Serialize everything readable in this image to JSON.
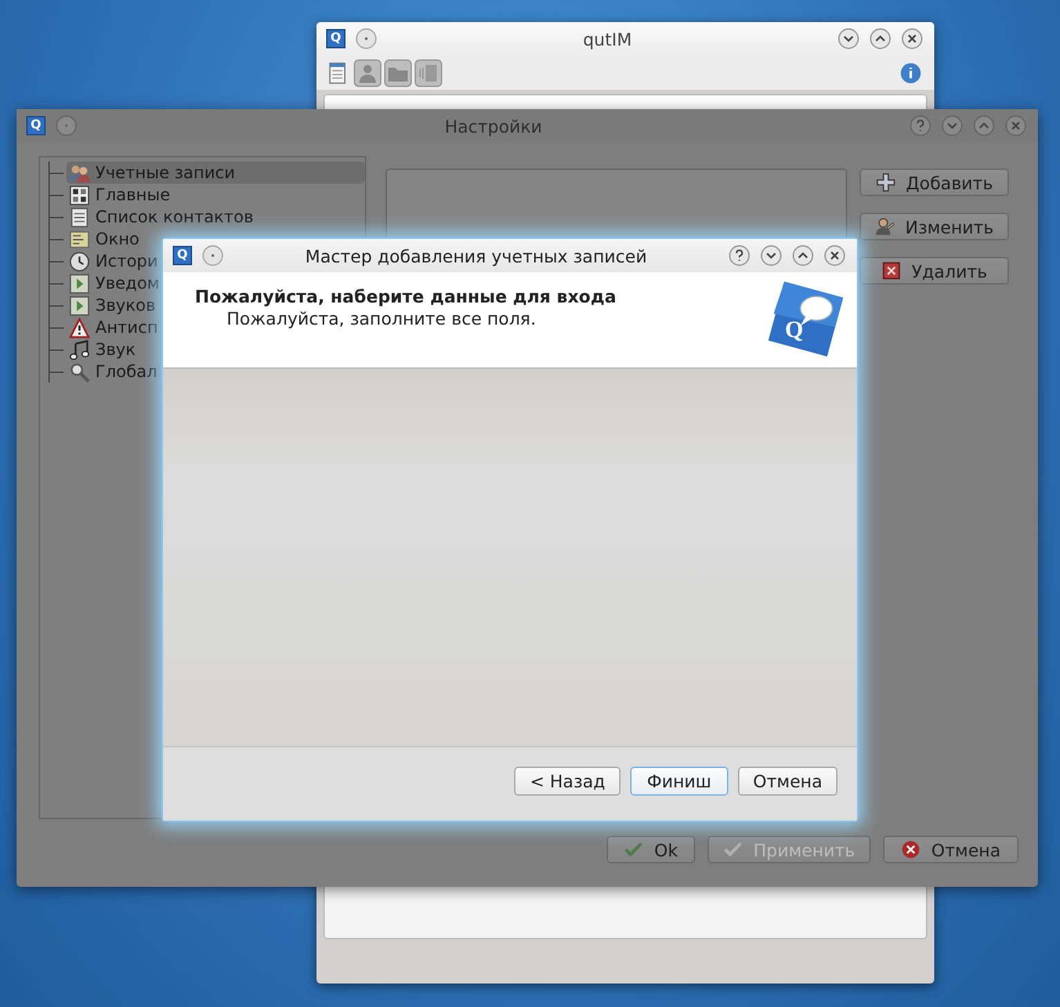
{
  "qutim_window": {
    "icon_letter": "Q",
    "title": "qutIM"
  },
  "settings_window": {
    "icon_letter": "Q",
    "title": "Настройки",
    "tree": [
      {
        "label": "Учетные записи",
        "kind": "accounts",
        "selected": true
      },
      {
        "label": "Главные",
        "kind": "general",
        "selected": false
      },
      {
        "label": "Список контактов",
        "kind": "contacts",
        "selected": false
      },
      {
        "label": "Окно",
        "kind": "chat",
        "selected": false
      },
      {
        "label": "Истори",
        "kind": "history",
        "selected": false
      },
      {
        "label": "Уведом",
        "kind": "notify",
        "selected": false
      },
      {
        "label": "Звуков",
        "kind": "notify",
        "selected": false
      },
      {
        "label": "Антисп",
        "kind": "antispam",
        "selected": false
      },
      {
        "label": "Звук",
        "kind": "sound",
        "selected": false
      },
      {
        "label": "Глобал",
        "kind": "global",
        "selected": false
      }
    ],
    "side_buttons": [
      {
        "label": "Добавить",
        "kind": "add"
      },
      {
        "label": "Изменить",
        "kind": "edit"
      },
      {
        "label": "Удалить",
        "kind": "delete"
      }
    ],
    "buttons": [
      {
        "label": "Ok",
        "kind": "ok",
        "disabled": false
      },
      {
        "label": "Применить",
        "kind": "ok",
        "disabled": true
      },
      {
        "label": "Отмена",
        "kind": "cancel",
        "disabled": false
      }
    ]
  },
  "wizard": {
    "icon_letter": "Q",
    "title": "Мастер добавления учетных записей",
    "heading": "Пожалуйста, наберите данные для входа",
    "subheading": "Пожалуйста, заполните все поля.",
    "logo_letter": "Q",
    "buttons": [
      {
        "label": "< Назад",
        "default": false
      },
      {
        "label": "Финиш",
        "default": true
      },
      {
        "label": "Отмена",
        "default": false
      }
    ]
  }
}
